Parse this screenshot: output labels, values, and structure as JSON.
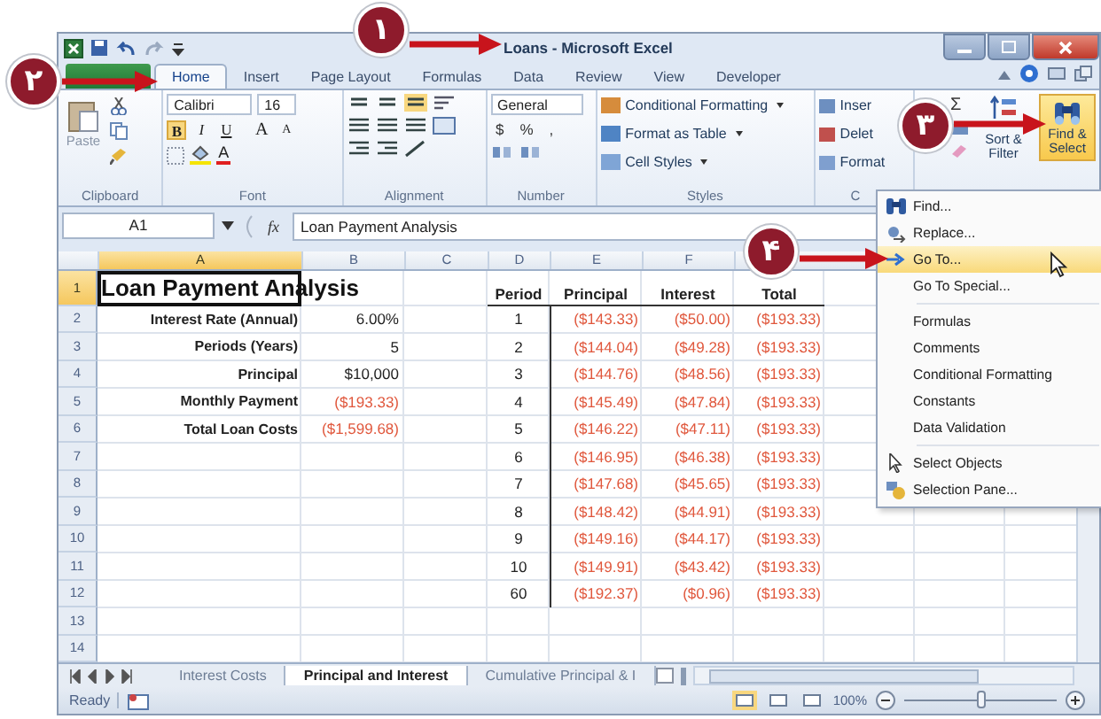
{
  "window": {
    "title": "Loans - Microsoft Excel"
  },
  "ribbon_tabs": [
    {
      "label": "Home",
      "selected": true
    },
    {
      "label": "Insert",
      "selected": false
    },
    {
      "label": "Page Layout",
      "selected": false
    },
    {
      "label": "Formulas",
      "selected": false
    },
    {
      "label": "Data",
      "selected": false
    },
    {
      "label": "Review",
      "selected": false
    },
    {
      "label": "View",
      "selected": false
    },
    {
      "label": "Developer",
      "selected": false
    }
  ],
  "ribbon": {
    "clipboard": {
      "paste": "Paste",
      "label": "Clipboard"
    },
    "font": {
      "name": "Calibri",
      "size": "16",
      "buttons": [
        {
          "label": "B",
          "selected": true
        },
        {
          "label": "I",
          "selected": false
        },
        {
          "label": "U",
          "selected": false
        },
        {
          "label": "A",
          "selected": false
        },
        {
          "label": "A",
          "selected": false
        }
      ],
      "color_button": "A",
      "label": "Font"
    },
    "alignment": {
      "label": "Alignment"
    },
    "number": {
      "format": "General",
      "buttons": [
        "$",
        "%",
        ","
      ],
      "label": "Number"
    },
    "styles": {
      "items": [
        "Conditional Formatting",
        "Format as Table",
        "Cell Styles"
      ],
      "label": "Styles"
    },
    "cells": {
      "items": [
        "Inser",
        "Delet",
        "Format"
      ],
      "label": "C"
    },
    "editing": {
      "sum": "Σ",
      "sort": "Sort & Filter",
      "find": {
        "label": "Find & Select",
        "selected": true
      }
    }
  },
  "formula_bar": {
    "name_box": "A1",
    "function_button": "fx",
    "formula": "Loan Payment Analysis"
  },
  "sheet": {
    "columns": [
      {
        "label": "A",
        "selected": true
      },
      {
        "label": "B",
        "selected": false
      },
      {
        "label": "C",
        "selected": false
      },
      {
        "label": "D",
        "selected": false
      },
      {
        "label": "E",
        "selected": false
      },
      {
        "label": "F",
        "selected": false
      }
    ],
    "rows": [
      {
        "label": "1",
        "selected": true
      },
      {
        "label": "2",
        "selected": false
      },
      {
        "label": "3",
        "selected": false
      },
      {
        "label": "4",
        "selected": false
      },
      {
        "label": "5",
        "selected": false
      },
      {
        "label": "6",
        "selected": false
      },
      {
        "label": "7",
        "selected": false
      },
      {
        "label": "8",
        "selected": false
      },
      {
        "label": "9",
        "selected": false
      },
      {
        "label": "10",
        "selected": false
      },
      {
        "label": "11",
        "selected": false
      },
      {
        "label": "12",
        "selected": false
      },
      {
        "label": "13",
        "selected": false
      },
      {
        "label": "14",
        "selected": false
      }
    ]
  },
  "summary": {
    "title": "Loan Payment Analysis",
    "items": [
      {
        "label": "Interest Rate (Annual)",
        "value": "6.00%",
        "negative": false
      },
      {
        "label": "Periods (Years)",
        "value": "5",
        "negative": false
      },
      {
        "label": "Principal",
        "value": "$10,000",
        "negative": false
      },
      {
        "label": "Monthly Payment",
        "value": "($193.33)",
        "negative": true
      },
      {
        "label": "Total Loan Costs",
        "value": "($1,599.68)",
        "negative": true
      }
    ]
  },
  "schedule": {
    "headers": [
      "Period",
      "Principal",
      "Interest",
      "Total"
    ],
    "rows": [
      {
        "period": "1",
        "principal": "($143.33)",
        "interest": "($50.00)",
        "total": "($193.33)"
      },
      {
        "period": "2",
        "principal": "($144.04)",
        "interest": "($49.28)",
        "total": "($193.33)"
      },
      {
        "period": "3",
        "principal": "($144.76)",
        "interest": "($48.56)",
        "total": "($193.33)"
      },
      {
        "period": "4",
        "principal": "($145.49)",
        "interest": "($47.84)",
        "total": "($193.33)"
      },
      {
        "period": "5",
        "principal": "($146.22)",
        "interest": "($47.11)",
        "total": "($193.33)"
      },
      {
        "period": "6",
        "principal": "($146.95)",
        "interest": "($46.38)",
        "total": "($193.33)"
      },
      {
        "period": "7",
        "principal": "($147.68)",
        "interest": "($45.65)",
        "total": "($193.33)"
      },
      {
        "period": "8",
        "principal": "($148.42)",
        "interest": "($44.91)",
        "total": "($193.33)"
      },
      {
        "period": "9",
        "principal": "($149.16)",
        "interest": "($44.17)",
        "total": "($193.33)"
      },
      {
        "period": "10",
        "principal": "($149.91)",
        "interest": "($43.42)",
        "total": "($193.33)"
      },
      {
        "period": "60",
        "principal": "($192.37)",
        "interest": "($0.96)",
        "total": "($193.33)"
      }
    ]
  },
  "menu": {
    "groups": [
      [
        {
          "label": "Find...",
          "kind": "find",
          "selected": false
        },
        {
          "label": "Replace...",
          "kind": "replace",
          "selected": false
        },
        {
          "label": "Go To...",
          "kind": "goto",
          "selected": true
        },
        {
          "label": "Go To Special...",
          "kind": "text",
          "selected": false
        }
      ],
      [
        {
          "label": "Formulas",
          "kind": "text",
          "selected": false
        },
        {
          "label": "Comments",
          "kind": "text",
          "selected": false
        },
        {
          "label": "Conditional Formatting",
          "kind": "text",
          "selected": false
        },
        {
          "label": "Constants",
          "kind": "text",
          "selected": false
        },
        {
          "label": "Data Validation",
          "kind": "text",
          "selected": false
        }
      ],
      [
        {
          "label": "Select Objects",
          "kind": "pointer",
          "selected": false
        },
        {
          "label": "Selection Pane...",
          "kind": "pane",
          "selected": false
        }
      ]
    ]
  },
  "sheet_tabs": [
    {
      "label": "Interest Costs",
      "selected": false
    },
    {
      "label": "Principal and Interest",
      "selected": true
    },
    {
      "label": "Cumulative Principal & I",
      "selected": false
    }
  ],
  "status_bar": {
    "status": "Ready",
    "view_buttons": [
      {
        "selected": true
      },
      {
        "selected": false
      },
      {
        "selected": false
      }
    ],
    "zoom": "100%",
    "zoom_slider": {
      "level": 0.5
    }
  },
  "callouts": [
    {
      "number": "۱"
    },
    {
      "number": "۲"
    },
    {
      "number": "۳"
    },
    {
      "number": "۴"
    }
  ]
}
